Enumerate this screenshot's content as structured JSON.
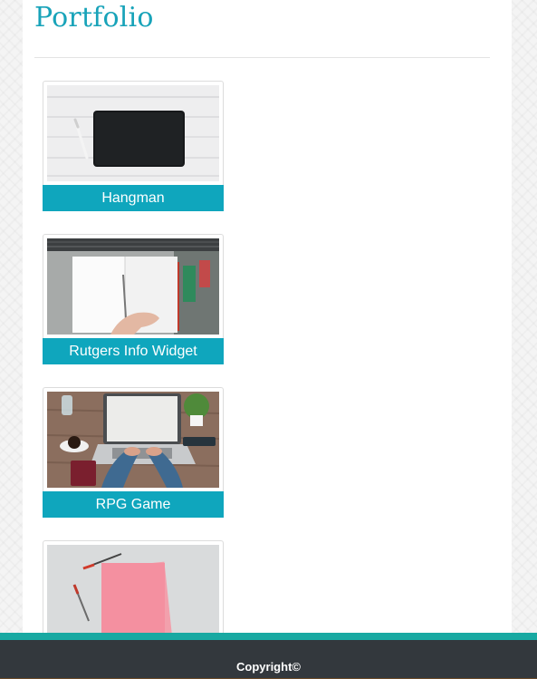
{
  "page": {
    "title": "Portfolio"
  },
  "projects": [
    {
      "label": "Hangman",
      "image": "tablet-on-desk-photo"
    },
    {
      "label": "Rutgers Info Widget",
      "image": "open-notebook-photo"
    },
    {
      "label": "RPG Game",
      "image": "laptop-typing-photo"
    },
    {
      "label": "",
      "image": "pink-papers-photo"
    }
  ],
  "footer": {
    "copyright": "Copyright©"
  },
  "colors": {
    "accent": "#18a3b9",
    "caption_background": "#0fa6bd",
    "footer_background": "#33383d",
    "footer_stripe": "#18a9a2"
  }
}
